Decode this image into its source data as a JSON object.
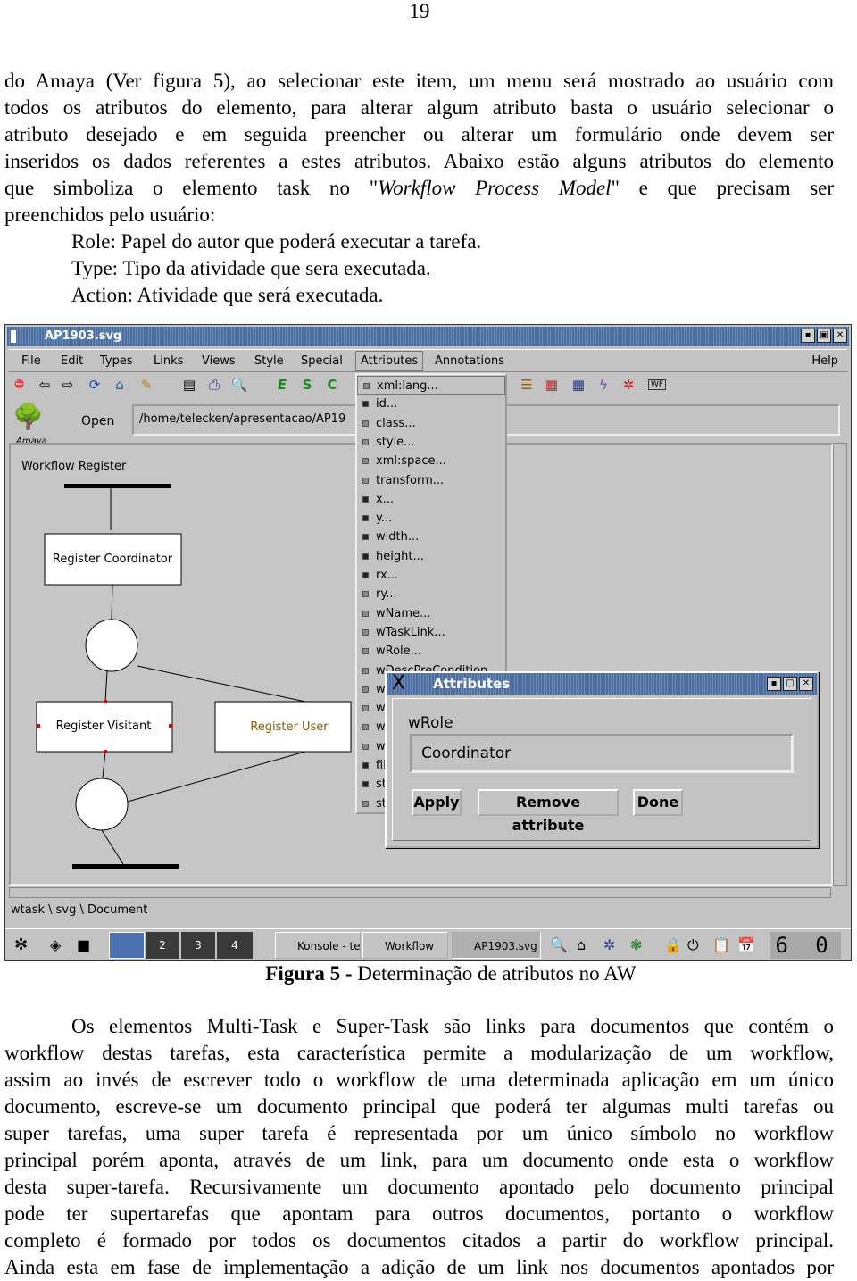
{
  "page_number": "19",
  "para1": [
    "do Amaya (Ver figura 5), ao selecionar este item, um menu será mostrado ao usuário com",
    "todos os atributos do elemento, para alterar algum atributo basta o usuário selecionar o",
    "atributo desejado e em seguida preencher ou alterar um formulário onde devem ser",
    "inseridos os dados referentes a estes atributos. Abaixo estão alguns  atributos do elemento"
  ],
  "para1_l5a": "que simboliza o elemento task no \"",
  "para1_l5i": "Workflow Process Model",
  "para1_l5b": "\" e que precisam ser",
  "para1_last": "preenchidos pelo usuário:",
  "list": [
    "Role: Papel do autor que poderá executar a tarefa.",
    "Type: Tipo da atividade que sera executada.",
    "Action: Atividade que será executada."
  ],
  "screenshot": {
    "window_title": "AP1903.svg",
    "menu": [
      "File",
      "Edit",
      "Types",
      "Links",
      "Views",
      "Style",
      "Special",
      "Attributes",
      "Annotations",
      "Help"
    ],
    "open_label": "Open",
    "url": "/home/telecken/apresentacao/AP19",
    "logo": "Amaya",
    "diagram": {
      "label": "Workflow Register",
      "tasks": [
        "Register Coordinator",
        "Register Visitant",
        "Register User"
      ]
    },
    "attributes_menu": [
      {
        "label": "xml:lang...",
        "on": false
      },
      {
        "label": "id...",
        "on": true
      },
      {
        "label": "class...",
        "on": false
      },
      {
        "label": "style...",
        "on": false
      },
      {
        "label": "xml:space...",
        "on": false
      },
      {
        "label": "transform...",
        "on": false
      },
      {
        "label": "x...",
        "on": true
      },
      {
        "label": "y...",
        "on": true
      },
      {
        "label": "width...",
        "on": true
      },
      {
        "label": "height...",
        "on": true
      },
      {
        "label": "rx...",
        "on": true
      },
      {
        "label": "ry...",
        "on": false
      },
      {
        "label": "wName...",
        "on": false
      },
      {
        "label": "wTaskLink...",
        "on": false
      },
      {
        "label": "wRole...",
        "on": false
      },
      {
        "label": "wDescPreCondition",
        "on": false
      },
      {
        "label": "wD",
        "on": false
      },
      {
        "label": "wD",
        "on": false
      },
      {
        "label": "wD",
        "on": false
      },
      {
        "label": "wS",
        "on": false
      },
      {
        "label": "fill",
        "on": true
      },
      {
        "label": "str",
        "on": true
      },
      {
        "label": "str",
        "on": false
      }
    ],
    "dialog": {
      "title": "Attributes",
      "field_label": "wRole",
      "value": "Coordinator",
      "apply": "Apply",
      "remove": "Remove attribute",
      "done": "Done"
    },
    "status": "wtask \\ svg \\ Document",
    "taskbar": {
      "desktops": [
        "",
        "2",
        "3",
        "4"
      ],
      "tasks": [
        "Konsole - te",
        "Workflow",
        "AP1903.svg"
      ],
      "clock": "6 0"
    }
  },
  "caption_bold": "Figura 5 -",
  "caption_rest": " Determinação de atributos no AW",
  "para2": [
    "Os elementos Multi-Task e Super-Task são links para documentos que contém o",
    "workflow destas tarefas, esta característica permite a modularização de um workflow,",
    "assim ao invés de escrever todo o workflow de uma determinada aplicação em um único",
    "documento, escreve-se um documento principal que poderá ter algumas multi tarefas ou",
    "super tarefas, uma super tarefa é representada por um único símbolo no workflow",
    "principal porém aponta, através de um link, para um documento onde esta o workflow",
    "desta super-tarefa. Recursivamente um documento apontado pelo documento principal",
    "pode ter supertarefas que apontam para outros documentos, portanto o workflow",
    "completo é formado por todos os documentos citados a partir do workflow principal.",
    "Ainda esta em fase de implementação a adição de um link nos documentos apontados por"
  ]
}
